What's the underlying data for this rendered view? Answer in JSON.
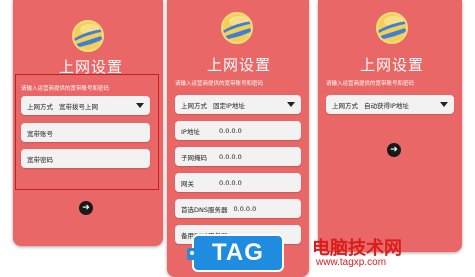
{
  "panels": [
    {
      "title": "上网设置",
      "hint": "请输入运营商提供的宽带账号和密码",
      "method_label": "上网方式",
      "method_value": "宽带拨号上网",
      "fields": [
        {
          "label": "宽带账号",
          "value": ""
        },
        {
          "label": "宽带密码",
          "value": ""
        }
      ]
    },
    {
      "title": "上网设置",
      "hint": "请输入运营商提供的宽带账号和密码",
      "method_label": "上网方式",
      "method_value": "固定IP地址",
      "fields": [
        {
          "label": "IP地址",
          "value": "0.0.0.0"
        },
        {
          "label": "子网掩码",
          "value": "0.0.0.0"
        },
        {
          "label": "网关",
          "value": "0.0.0.0"
        },
        {
          "label": "首选DNS服务器",
          "value": "0.0.0.0"
        },
        {
          "label": "备用DNS服务器",
          "value": ""
        }
      ]
    },
    {
      "title": "上网设置",
      "hint": "请输入运营商提供的宽带账号和密码",
      "method_label": "上网方式",
      "method_value": "自动获得IP地址",
      "fields": []
    }
  ],
  "watermark": {
    "tag": "TAG",
    "site_name": "电脑技术网",
    "site_url": "www.tagxp.com"
  },
  "icons": {
    "next": "arrow-right-circle-icon",
    "dropdown": "caret-down-icon",
    "logo": "planet-logo-icon"
  },
  "colors": {
    "panel_bg": "#e96766",
    "highlight": "#c81e1e",
    "tag_blue": "#1f8ce0",
    "site_red": "#d91d1d"
  }
}
